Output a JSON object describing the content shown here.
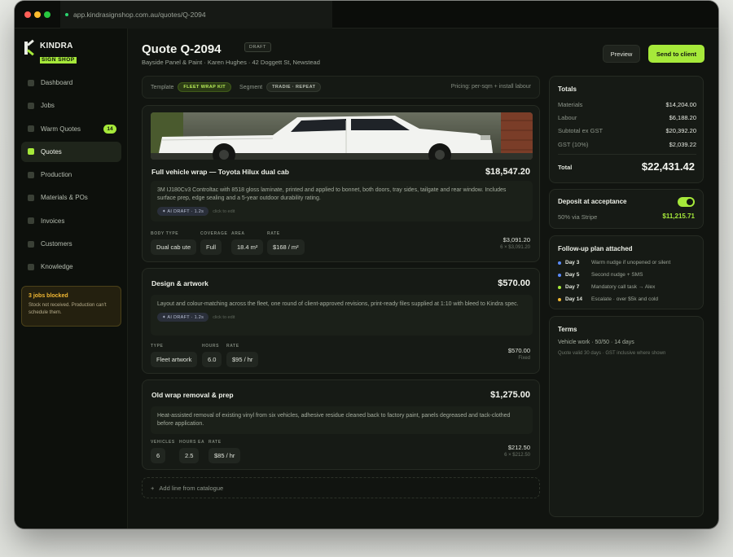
{
  "browser": {
    "url": "app.kindrasignshop.com.au/quotes/Q-2094"
  },
  "brand": {
    "name": "KINDRA",
    "tagline": "SIGN SHOP"
  },
  "sidebar": {
    "items": [
      {
        "label": "Dashboard"
      },
      {
        "label": "Jobs"
      },
      {
        "label": "Warm Quotes",
        "badge": "14"
      },
      {
        "label": "Quotes"
      },
      {
        "label": "Production"
      },
      {
        "label": "Materials & POs"
      },
      {
        "label": "Invoices"
      },
      {
        "label": "Customers"
      },
      {
        "label": "Knowledge"
      }
    ],
    "alert": {
      "title": "3 jobs blocked",
      "text": "Stock not received. Production can't schedule them."
    }
  },
  "header": {
    "title": "Quote Q-2094",
    "status": "DRAFT",
    "subtitle": "Bayside Panel & Paint · Karen Hughes · 42 Doggett St, Newstead",
    "preview_label": "Preview",
    "send_label": "Send to client"
  },
  "template_bar": {
    "template_label": "Template",
    "template_value": "FLEET WRAP KIT",
    "segment_label": "Segment",
    "segment_value": "TRADIE · REPEAT",
    "pricing": "Pricing: per-sqm + install labour"
  },
  "lines": [
    {
      "title": "Full vehicle wrap — Toyota Hilux dual cab",
      "total": "$18,547.20",
      "description": "3M IJ180Cv3 Controltac with 8518 gloss laminate, printed and applied to bonnet, both doors, tray sides, tailgate and rear window. Includes surface prep, edge sealing and a 5-year outdoor durability rating.",
      "ai": "✦ AI DRAFT · 1.2s",
      "ai_hint": "click to edit",
      "fields": [
        {
          "label": "BODY TYPE",
          "value": "Dual cab ute"
        },
        {
          "label": "COVERAGE",
          "value": "Full"
        },
        {
          "label": "AREA",
          "value": "18.4 m²"
        },
        {
          "label": "RATE",
          "value": "$168 / m²"
        }
      ],
      "line_amount": "$3,091.20",
      "line_sub": "6 × $3,091.20"
    },
    {
      "title": "Design & artwork",
      "total": "$570.00",
      "description": "Layout and colour-matching across the fleet, one round of client-approved revisions, print-ready files supplied at 1:10 with bleed to Kindra spec.",
      "ai": "✦ AI DRAFT · 1.2s",
      "ai_hint": "click to edit",
      "fields": [
        {
          "label": "TYPE",
          "value": "Fleet artwork"
        },
        {
          "label": "HOURS",
          "value": "6.0"
        },
        {
          "label": "RATE",
          "value": "$95 / hr"
        }
      ],
      "line_amount": "$570.00",
      "line_sub": "Fixed"
    },
    {
      "title": "Old wrap removal & prep",
      "total": "$1,275.00",
      "description": "Heat-assisted removal of existing vinyl from six vehicles, adhesive residue cleaned back to factory paint, panels degreased and tack-clothed before application.",
      "fields": [
        {
          "label": "VEHICLES",
          "value": "6"
        },
        {
          "label": "HOURS EA",
          "value": "2.5"
        },
        {
          "label": "RATE",
          "value": "$85 / hr"
        }
      ],
      "line_amount": "$212.50",
      "line_sub": "6 × $212.50"
    }
  ],
  "add_line_label": "Add line from catalogue",
  "totals": {
    "title": "Totals",
    "rows": [
      {
        "k": "Materials",
        "v": "$14,204.00"
      },
      {
        "k": "Labour",
        "v": "$6,188.20"
      },
      {
        "k": "Subtotal ex GST",
        "v": "$20,392.20"
      },
      {
        "k": "GST (10%)",
        "v": "$2,039.22"
      }
    ],
    "total_label": "Total",
    "total_value": "$22,431.42"
  },
  "deposit": {
    "title": "Deposit at acceptance",
    "method": "50% via Stripe",
    "amount": "$11,215.71",
    "enabled": true
  },
  "followup": {
    "title": "Follow-up plan attached",
    "steps": [
      {
        "day": "Day 3",
        "text": "Warm nudge if unopened or silent",
        "color": "#5b8cff"
      },
      {
        "day": "Day 5",
        "text": "Second nudge + SMS",
        "color": "#5b8cff"
      },
      {
        "day": "Day 7",
        "text": "Mandatory call task → Alex",
        "color": "#a6e93a"
      },
      {
        "day": "Day 14",
        "text": "Escalate · over $5k and cold",
        "color": "#f2b833"
      }
    ]
  },
  "terms": {
    "title": "Terms",
    "line1": "Vehicle work · 50/50 · 14 days",
    "line2": "Quote valid 30 days · GST inclusive where shown"
  },
  "colors": {
    "accent": "#a6e93a",
    "background": "#111410",
    "warning": "#f2b833"
  }
}
